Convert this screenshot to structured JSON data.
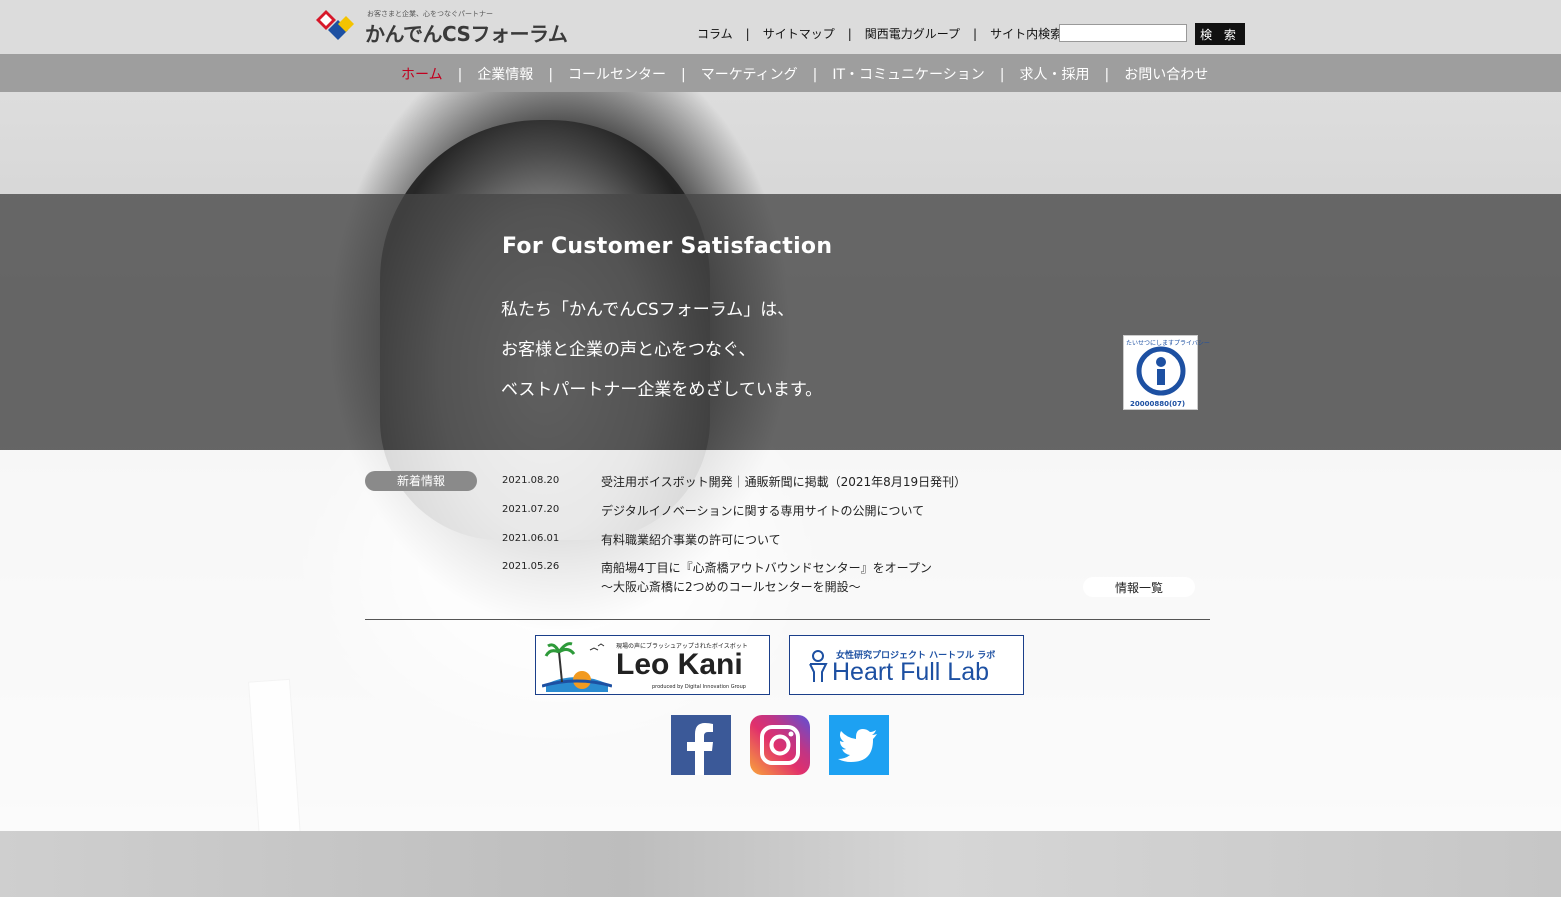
{
  "header": {
    "logo_tagline": "お客さまと企業、心をつなぐパートナー",
    "logo_name": "かんでんCSフォーラム",
    "links": [
      "コラム",
      "サイトマップ",
      "関西電力グループ",
      "サイト内検索"
    ],
    "search_button": "検 索",
    "search_value": ""
  },
  "nav": {
    "items": [
      "ホーム",
      "企業情報",
      "コールセンター",
      "マーケティング",
      "IT・コミュニケーション",
      "求人・採用",
      "お問い合わせ"
    ],
    "active_index": 0
  },
  "hero": {
    "title": "For Customer Satisfaction",
    "lines": [
      "私たち「かんでんCSフォーラム」は、",
      "お客様と企業の声と心をつなぐ、",
      "ベストパートナー企業をめざしています。"
    ],
    "privacy_mark": {
      "text": "たいせつにしますプライバシー",
      "number": "20000880(07)"
    }
  },
  "news": {
    "badge": "新着情報",
    "items": [
      {
        "date": "2021.08.20",
        "text": "受注用ボイスボット開発｜通販新聞に掲載（2021年8月19日発刊）"
      },
      {
        "date": "2021.07.20",
        "text": "デジタルイノベーションに関する専用サイトの公開について"
      },
      {
        "date": "2021.06.01",
        "text": "有料職業紹介事業の許可について"
      },
      {
        "date": "2021.05.26",
        "text": "南船場4丁目に『心斎橋アウトバウンドセンター』をオープン",
        "text2": "～大阪心斎橋に2つめのコールセンターを開設～"
      }
    ],
    "more": "情報一覧"
  },
  "banners": {
    "leokani": {
      "small": "現場の声にブラッシュアップされたボイスボット",
      "name": "Leo Kani",
      "sub": "produced by Digital Innovation Group"
    },
    "heartfull": {
      "small": "女性研究プロジェクト ハートフル ラボ",
      "name": "Heart Full Lab"
    }
  },
  "social": [
    "facebook-icon",
    "instagram-icon",
    "twitter-icon"
  ],
  "colors": {
    "accent_red": "#c1001f",
    "facebook": "#3b5998",
    "twitter": "#1da1f2",
    "banner_blue": "#1b3f8a"
  }
}
